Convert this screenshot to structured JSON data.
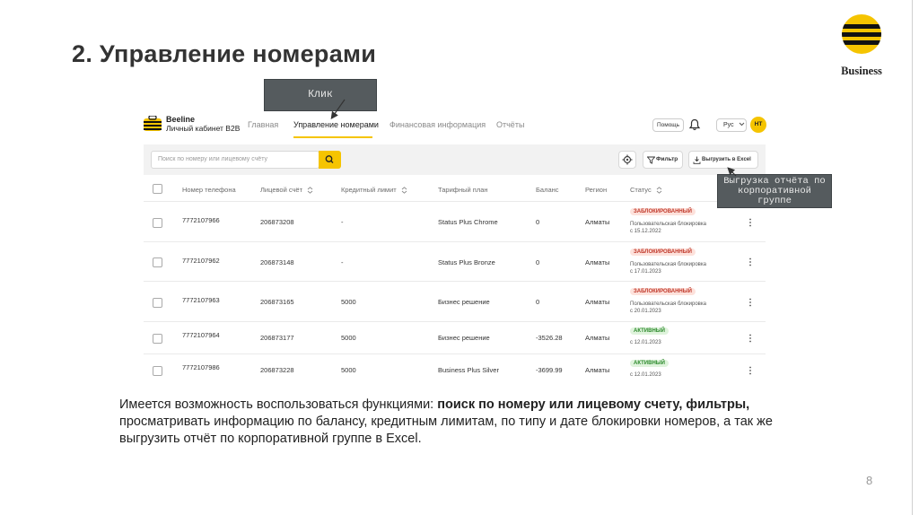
{
  "slide": {
    "title": "2. Управление номерами",
    "brand": "Business",
    "page_number": "8"
  },
  "callouts": {
    "click": "Клик",
    "export": "Выгрузка отчёта по корпоративной группе"
  },
  "app": {
    "logo_name": "Beeline",
    "logo_sub": "Личный кабинет B2B",
    "nav": [
      "Главная",
      "Управление номерами",
      "Финансовая информация",
      "Отчёты"
    ],
    "active_nav": "Управление номерами",
    "help_label": "Помощь",
    "lang_label": "Рус",
    "avatar_initials": "НТ",
    "search_placeholder": "Поиск по номеру или лицевому счёту",
    "filter_label": "Фильтр",
    "export_label": "Выгрузить в Excel",
    "accent_color": "#f5c400",
    "columns": [
      "Номер телефона",
      "Лицевой счёт",
      "Кредитный лимит",
      "Тарифный план",
      "Баланс",
      "Регион",
      "Статус"
    ],
    "rows": [
      {
        "phone": "7772107966",
        "account": "206873208",
        "limit": "-",
        "plan": "Status Plus Chrome",
        "balance": "0",
        "region": "Алматы",
        "status": "ЗАБЛОКИРОВАННЫЙ",
        "status_type": "blocked",
        "note": "Пользовательская блокировка",
        "date": "с 15.12.2022"
      },
      {
        "phone": "7772107962",
        "account": "206873148",
        "limit": "-",
        "plan": "Status Plus Bronze",
        "balance": "0",
        "region": "Алматы",
        "status": "ЗАБЛОКИРОВАННЫЙ",
        "status_type": "blocked",
        "note": "Пользовательская блокировка",
        "date": "с 17.01.2023"
      },
      {
        "phone": "7772107963",
        "account": "206873165",
        "limit": "5000",
        "plan": "Бизнес решение",
        "balance": "0",
        "region": "Алматы",
        "status": "ЗАБЛОКИРОВАННЫЙ",
        "status_type": "blocked",
        "note": "Пользовательская блокировка",
        "date": "с 20.01.2023"
      },
      {
        "phone": "7772107964",
        "account": "206873177",
        "limit": "5000",
        "plan": "Бизнес решение",
        "balance": "-3526.28",
        "region": "Алматы",
        "status": "АКТИВНЫЙ",
        "status_type": "active",
        "note": "",
        "date": "с 12.01.2023"
      },
      {
        "phone": "7772107986",
        "account": "206873228",
        "limit": "5000",
        "plan": "Business Plus Silver",
        "balance": "-3699.99",
        "region": "Алматы",
        "status": "АКТИВНЫЙ",
        "status_type": "active",
        "note": "",
        "date": "с 12.01.2023"
      }
    ]
  },
  "description": {
    "lead": "Имеется возможность воспользоваться функциями: ",
    "bold": "поиск по номеру или лицевому счету, фильтры,",
    "rest": "просматривать информацию по балансу, кредитным лимитам, по типу и дате блокировки номеров, а так же выгрузить отчёт по корпоративной группе в Excel."
  }
}
